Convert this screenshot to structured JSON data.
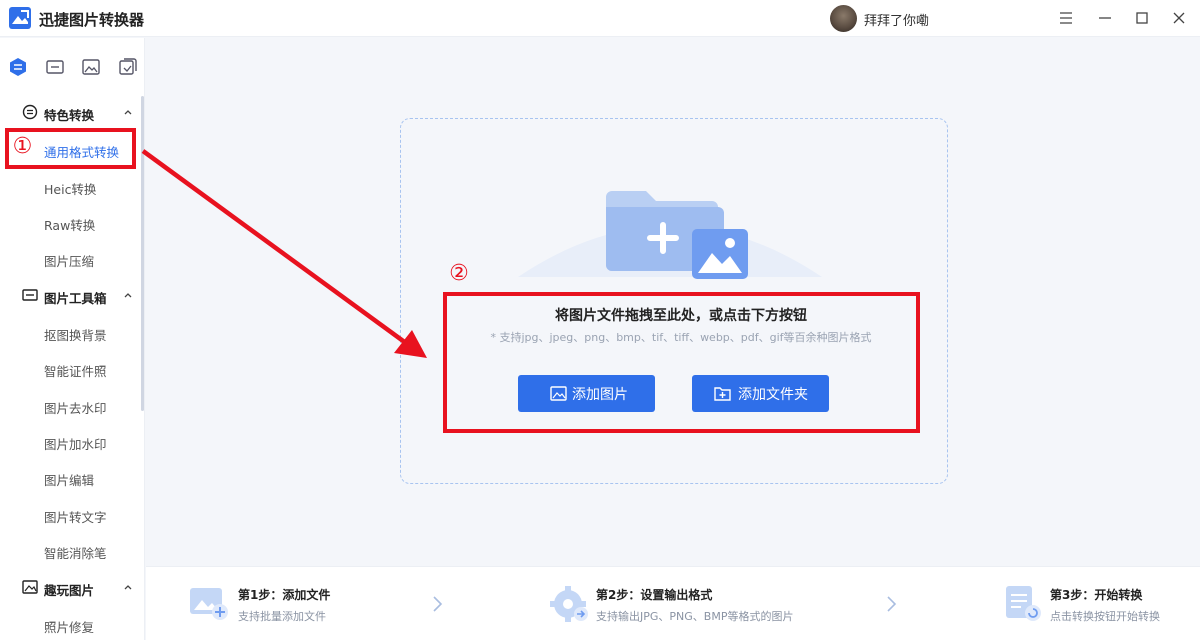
{
  "app": {
    "title": "迅捷图片转换器"
  },
  "user": {
    "name": "拜拜了你嘞"
  },
  "window_controls": [
    "menu-icon",
    "minimize-icon",
    "maximize-icon",
    "close-icon"
  ],
  "sidebar": {
    "top_icons": [
      "convert-icon",
      "toolbox-icon",
      "image-icon",
      "fun-icon"
    ],
    "sections": [
      {
        "label": "特色转换",
        "items": [
          "通用格式转换",
          "Heic转换",
          "Raw转换",
          "图片压缩"
        ]
      },
      {
        "label": "图片工具箱",
        "items": [
          "抠图换背景",
          "智能证件照",
          "图片去水印",
          "图片加水印",
          "图片编辑",
          "图片转文字",
          "智能消除笔"
        ]
      },
      {
        "label": "趣玩图片",
        "items": [
          "照片修复"
        ]
      }
    ],
    "active_item": "通用格式转换"
  },
  "annotations": {
    "mark1": "①",
    "mark2": "②"
  },
  "dropzone": {
    "title": "将图片文件拖拽至此处，或点击下方按钮",
    "subtitle": "* 支持jpg、jpeg、png、bmp、tif、tiff、webp、pdf、gif等百余种图片格式",
    "add_image": "添加图片",
    "add_folder": "添加文件夹"
  },
  "steps": [
    {
      "title": "第1步：添加文件",
      "desc": "支持批量添加文件"
    },
    {
      "title": "第2步：设置输出格式",
      "desc": "支持输出JPG、PNG、BMP等格式的图片"
    },
    {
      "title": "第3步：开始转换",
      "desc": "点击转换按钮开始转换"
    }
  ],
  "colors": {
    "accent": "#2f6fe9",
    "annotation": "#e8121f"
  }
}
